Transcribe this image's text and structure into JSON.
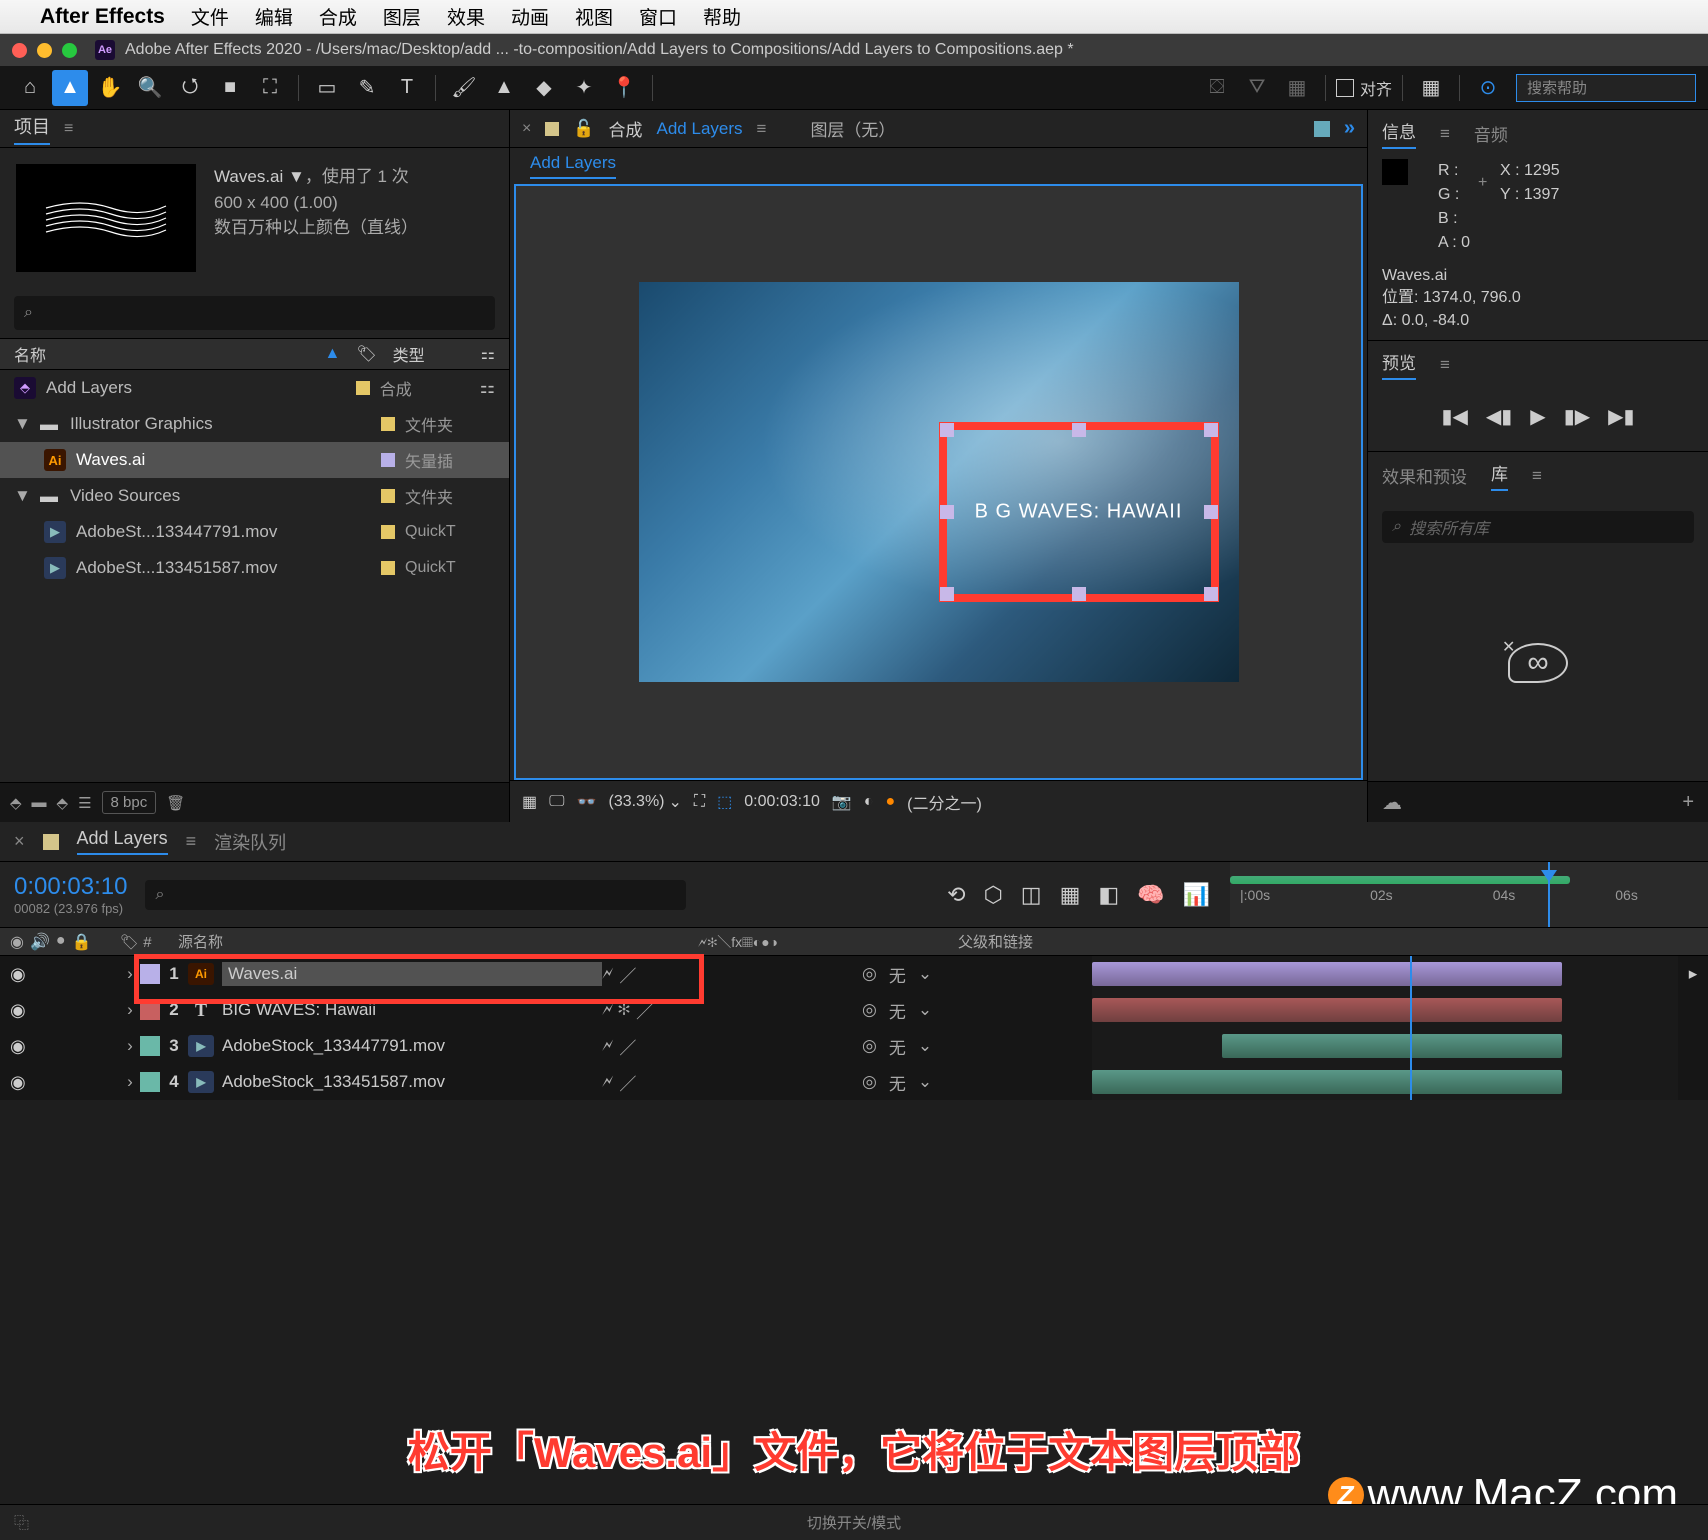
{
  "menubar": {
    "app": "After Effects",
    "items": [
      "文件",
      "编辑",
      "合成",
      "图层",
      "效果",
      "动画",
      "视图",
      "窗口",
      "帮助"
    ]
  },
  "window": {
    "title": "Adobe After Effects 2020 - /Users/mac/Desktop/add ... -to-composition/Add Layers to Compositions/Add Layers to Compositions.aep *"
  },
  "toolbar": {
    "align_label": "对齐",
    "search_placeholder": "搜索帮助"
  },
  "project": {
    "tab": "项目",
    "asset": {
      "name": "Waves.ai ▼",
      "usage": "，使用了 1 次",
      "dims": "600 x 400 (1.00)",
      "colors": "数百万种以上颜色（直线）"
    },
    "cols": {
      "name": "名称",
      "type": "类型"
    },
    "items": [
      {
        "name": "Add Layers",
        "type": "合成",
        "icon": "comp",
        "swatch": "ylw",
        "indent": 0
      },
      {
        "name": "Illustrator Graphics",
        "type": "文件夹",
        "icon": "folder",
        "swatch": "ylw",
        "indent": 0,
        "twisty": "▼"
      },
      {
        "name": "Waves.ai",
        "type": "矢量插",
        "icon": "ai",
        "swatch": "lav",
        "indent": 1,
        "selected": true
      },
      {
        "name": "Video Sources",
        "type": "文件夹",
        "icon": "folder",
        "swatch": "ylw",
        "indent": 0,
        "twisty": "▼"
      },
      {
        "name": "AdobeSt...133447791.mov",
        "type": "QuickT",
        "icon": "mov",
        "swatch": "ylw",
        "indent": 1
      },
      {
        "name": "AdobeSt...133451587.mov",
        "type": "QuickT",
        "icon": "mov",
        "swatch": "ylw",
        "indent": 1
      }
    ],
    "bpc": "8 bpc"
  },
  "comp": {
    "tab_prefix": "合成",
    "tab_name": "Add Layers",
    "layer_label": "图层（无）",
    "subtab": "Add Layers",
    "overlay_text": "B G WAVES: HAWAII",
    "footer": {
      "zoom": "(33.3%)",
      "time": "0:00:03:10",
      "res": "(二分之一)"
    }
  },
  "info": {
    "tab1": "信息",
    "tab2": "音频",
    "r": "R :",
    "g": "G :",
    "b": "B :",
    "a": "A :  0",
    "x": "X : 1295",
    "y": "Y : 1397",
    "asset": "Waves.ai",
    "pos": "位置: 1374.0, 796.0",
    "delta": "Δ: 0.0, -84.0"
  },
  "preview": {
    "tab": "预览"
  },
  "effects": {
    "tab1": "效果和预设",
    "tab2": "库",
    "search": "搜索所有库"
  },
  "timeline": {
    "tab1": "Add Layers",
    "tab2": "渲染队列",
    "timecode": "0:00:03:10",
    "fps": "00082 (23.976 fps)",
    "col_source": "源名称",
    "col_parent": "父级和链接",
    "ruler": [
      "|:00s",
      "02s",
      "04s",
      "06s"
    ],
    "layers": [
      {
        "n": "1",
        "name": "Waves.ai",
        "icon": "ai",
        "sw": "sw-lav",
        "bar": "lav",
        "parent": "无",
        "highlighted": true
      },
      {
        "n": "2",
        "name": "BIG WAVES: Hawaii",
        "icon": "txt",
        "sw": "sw-red",
        "bar": "red",
        "parent": "无"
      },
      {
        "n": "3",
        "name": "AdobeStock_133447791.mov",
        "icon": "mov",
        "sw": "sw-teal",
        "bar": "teal1",
        "parent": "无"
      },
      {
        "n": "4",
        "name": "AdobeStock_133451587.mov",
        "icon": "mov",
        "sw": "sw-teal",
        "bar": "teal2",
        "parent": "无"
      }
    ]
  },
  "bottom": {
    "switch": "切换开关/模式"
  },
  "annotation": "松开「Waves.ai」文件，它将位于文本图层顶部",
  "watermark": "www.MacZ.com"
}
